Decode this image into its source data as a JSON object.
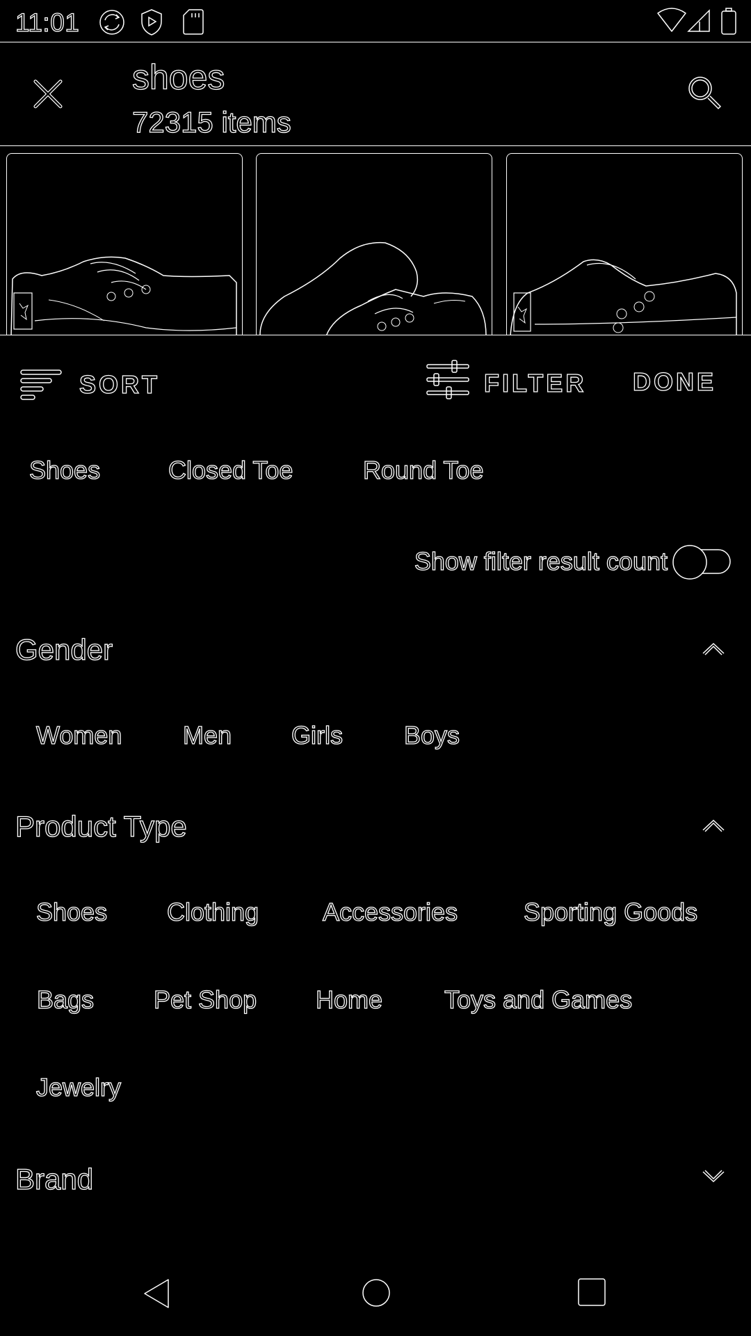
{
  "status_bar": {
    "time": "11:01",
    "icons": [
      "sync-icon",
      "play-protect-icon",
      "sd-card-icon",
      "wifi-icon",
      "cell-signal-icon",
      "battery-icon"
    ]
  },
  "search": {
    "query": "shoes",
    "count": "72315 items"
  },
  "toolbar": {
    "sort_label": "SORT",
    "filter_label": "FILTER",
    "done_label": "DONE"
  },
  "applied_filters": [
    "Shoes",
    "Closed Toe",
    "Round Toe"
  ],
  "toggle": {
    "label": "Show filter result count",
    "on": false
  },
  "sections": {
    "gender": {
      "title": "Gender",
      "expanded": true,
      "options": [
        "Women",
        "Men",
        "Girls",
        "Boys"
      ]
    },
    "product_type": {
      "title": "Product Type",
      "expanded": true,
      "options": [
        "Shoes",
        "Clothing",
        "Accessories",
        "Sporting Goods",
        "Bags",
        "Pet Shop",
        "Home",
        "Toys and Games",
        "Jewelry"
      ]
    },
    "brand": {
      "title": "Brand",
      "expanded": false
    }
  },
  "colors": {
    "background": "#000000",
    "foreground": "#ffffff"
  }
}
